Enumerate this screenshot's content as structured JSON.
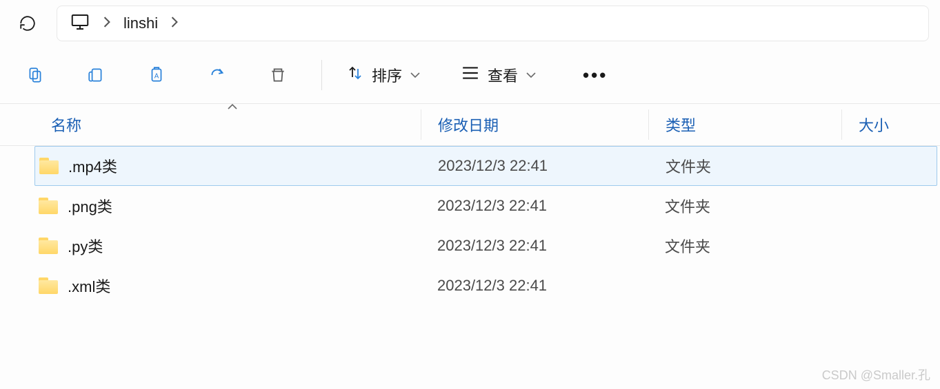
{
  "breadcrumb": {
    "root_icon": "computer-icon",
    "items": [
      "linshi"
    ]
  },
  "toolbar": {
    "sort_label": "排序",
    "view_label": "查看"
  },
  "columns": {
    "name": "名称",
    "date": "修改日期",
    "type": "类型",
    "size": "大小"
  },
  "files": [
    {
      "name": ".mp4类",
      "date": "2023/12/3 22:41",
      "type": "文件夹",
      "size": "",
      "selected": true
    },
    {
      "name": ".png类",
      "date": "2023/12/3 22:41",
      "type": "文件夹",
      "size": "",
      "selected": false
    },
    {
      "name": ".py类",
      "date": "2023/12/3 22:41",
      "type": "文件夹",
      "size": "",
      "selected": false
    },
    {
      "name": ".xml类",
      "date": "2023/12/3 22:41",
      "type": "",
      "size": "",
      "selected": false
    }
  ],
  "watermark": "CSDN @Smaller.孔"
}
